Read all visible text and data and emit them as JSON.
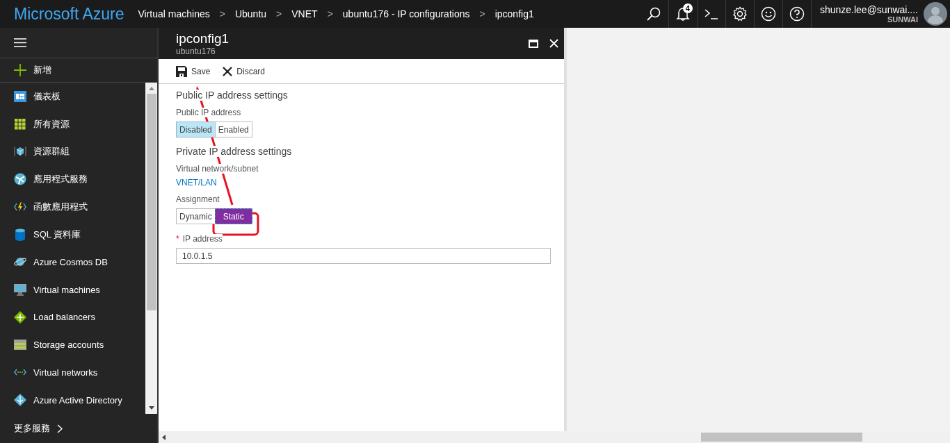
{
  "topbar": {
    "brand": "Microsoft Azure",
    "breadcrumbs": [
      "Virtual machines",
      "Ubuntu",
      "VNET",
      "ubuntu176 - IP configurations",
      "ipconfig1"
    ],
    "separator": ">",
    "notifications": "4",
    "account": {
      "email": "shunze.lee@sunwai....",
      "tenant": "SUNWAI"
    }
  },
  "sidebar": {
    "new_label": "新增",
    "items": [
      {
        "label": "儀表板"
      },
      {
        "label": "所有資源"
      },
      {
        "label": "資源群組"
      },
      {
        "label": "應用程式服務"
      },
      {
        "label": "函數應用程式"
      },
      {
        "label": "SQL 資料庫"
      },
      {
        "label": "Azure Cosmos DB"
      },
      {
        "label": "Virtual machines"
      },
      {
        "label": "Load balancers"
      },
      {
        "label": "Storage accounts"
      },
      {
        "label": "Virtual networks"
      },
      {
        "label": "Azure Active Directory"
      }
    ],
    "more_label": "更多服務"
  },
  "blade": {
    "title": "ipconfig1",
    "subtitle": "ubuntu176",
    "toolbar": [
      "Save",
      "Discard"
    ],
    "public_section": {
      "heading": "Public IP address settings",
      "label": "Public IP address",
      "focused": false,
      "options": [
        {
          "label": "Disabled",
          "selected": true
        },
        {
          "label": "Enabled",
          "selected": false
        }
      ]
    },
    "private_section": {
      "heading": "Private IP address settings",
      "subnet_label": "Virtual network/subnet",
      "subnet_link": "VNET/LAN",
      "assignment_label": "Assignment",
      "focused": true,
      "options": [
        {
          "label": "Dynamic",
          "selected": false
        },
        {
          "label": "Static",
          "selected": true
        }
      ]
    },
    "ip_field": {
      "label": "IP address",
      "required": true,
      "required_mark": "*",
      "value": "10.0.1.5"
    }
  }
}
